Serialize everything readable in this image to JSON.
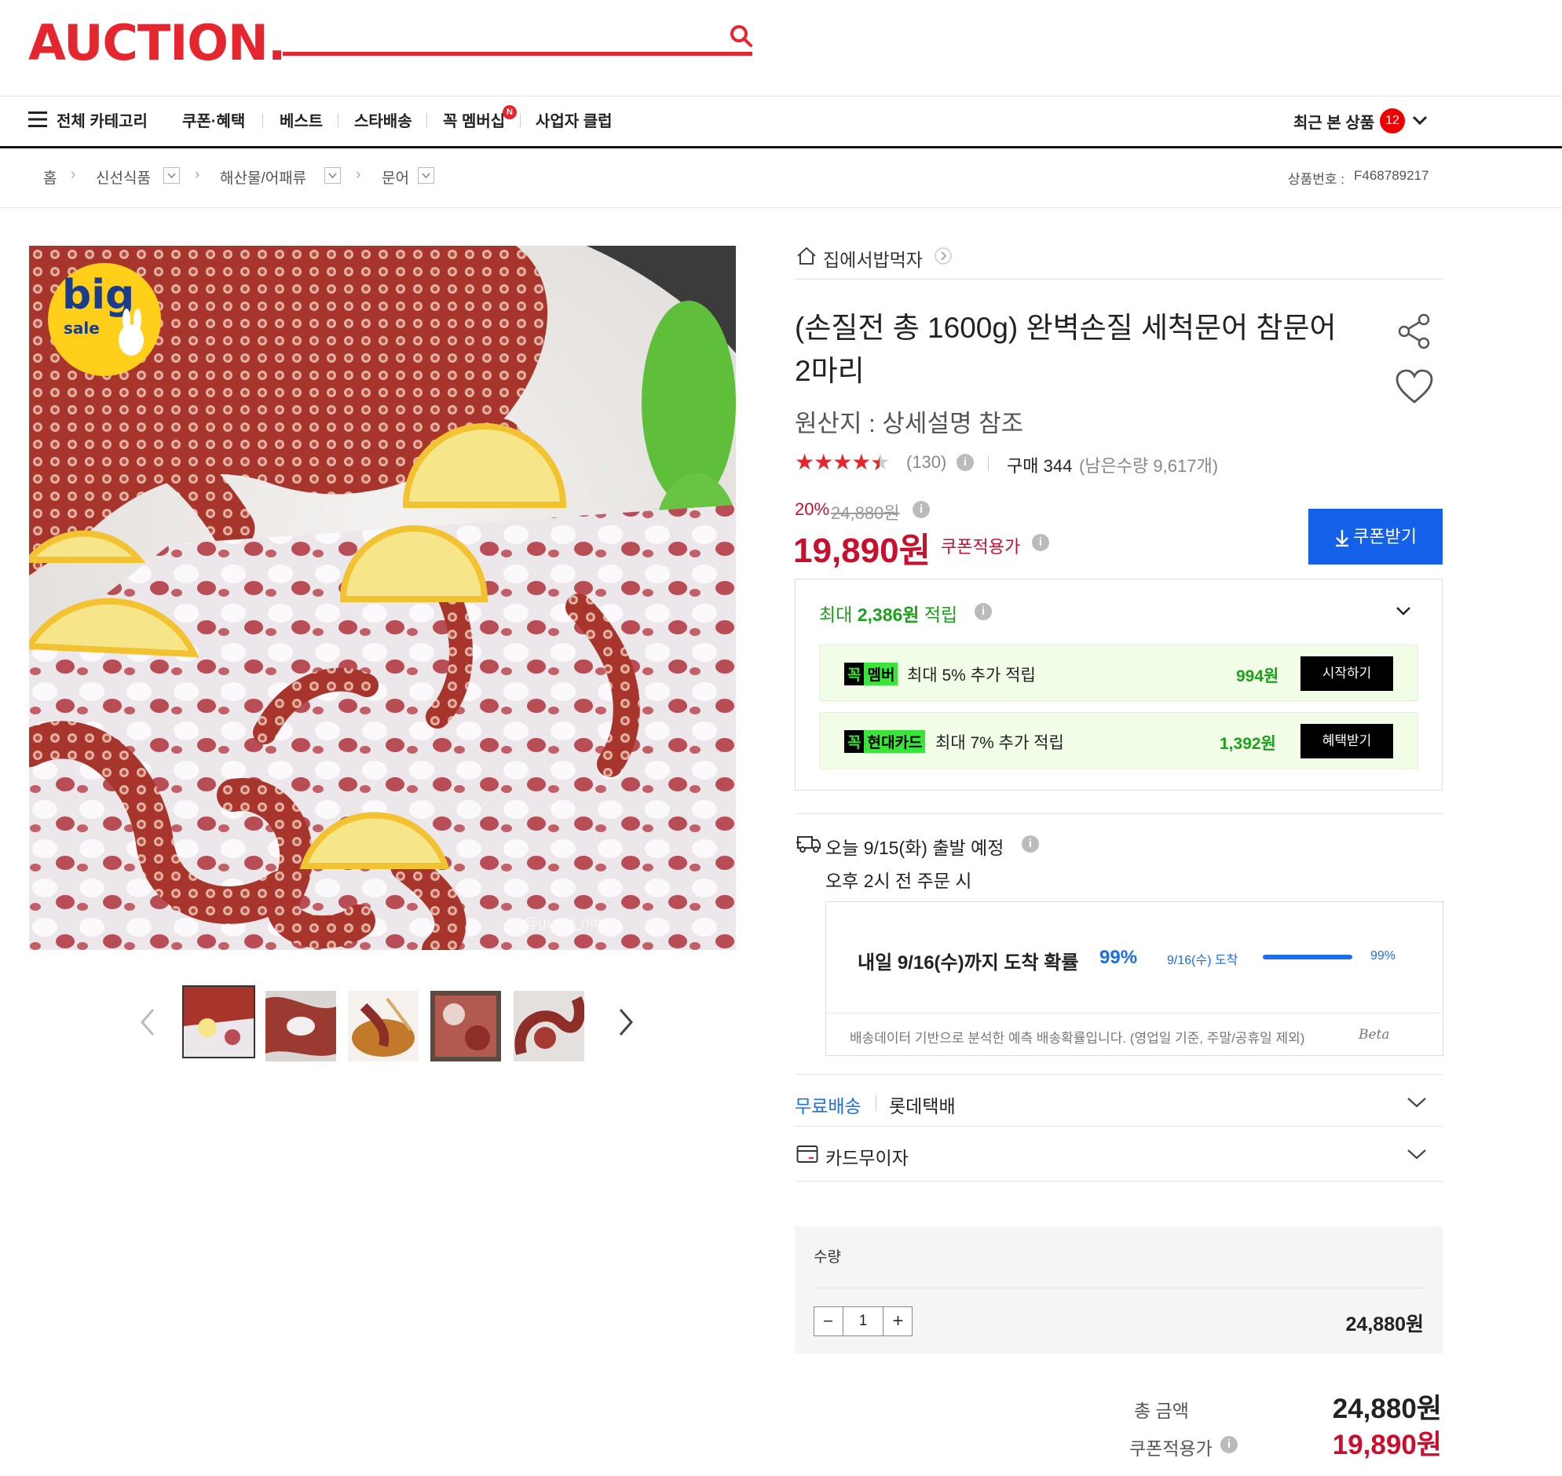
{
  "header": {
    "logo": "AUCTION.",
    "nav": {
      "all_category": "전체 카테고리",
      "items": [
        "쿠폰·혜택",
        "베스트",
        "스타배송",
        "꼭 멤버십",
        "사업자 클럽"
      ],
      "new_badge": "N",
      "recent_label": "최근 본 상품",
      "recent_count": "12"
    }
  },
  "breadcrumb": {
    "home": "홈",
    "levels": [
      "신선식품",
      "해산물/어패류",
      "문어"
    ],
    "product_no_label": "상품번호 :",
    "product_no": "F468789217"
  },
  "product": {
    "badge_big": "big",
    "badge_sale": "sale",
    "watermark": "@gugu_nini",
    "seller": "집에서밥먹자",
    "title": "(손질전 총 1600g) 완벽손질 세척문어 참문어 2마리",
    "origin": "원산지 : 상세설명 참조",
    "rating": 4.5,
    "review_count": "(130)",
    "purchase_label": "구매 344",
    "stock": "(남은수량 9,617개)",
    "discount_rate": "20%",
    "original_price": "24,880원",
    "coupon_price": "19,890원",
    "coupon_price_label": "쿠폰적용가",
    "coupon_button": "쿠폰받기"
  },
  "rewards": {
    "max_label_pre": "최대 ",
    "max_amount": "2,386원",
    "max_label_post": " 적립",
    "rows": [
      {
        "tag1": "꼭",
        "tag2": "멤버",
        "text": "최대 5% 추가 적립",
        "amount": "994원",
        "button": "시작하기"
      },
      {
        "tag1": "꼭",
        "tag2": "현대카드",
        "text": "최대 7% 추가 적립",
        "amount": "1,392원",
        "button": "혜택받기"
      }
    ]
  },
  "delivery": {
    "ship_text": "오늘 9/15(화) 출발 예정",
    "cutoff": "오후 2시 전 주문 시",
    "arrival_text": "내일 9/16(수)까지 도착 확률",
    "arrival_prob": "99%",
    "bar_label": "9/16(수) 도착",
    "bar_pct": "99%",
    "bar_fraction": 0.99,
    "note": "배송데이터 기반으로 분석한 예측 배송확률입니다. (영업일 기준, 주말/공휴일 제외)",
    "beta": "Beta",
    "free_shipping": "무료배송",
    "carrier": "롯데택배",
    "card_installment": "카드무이자"
  },
  "quantity": {
    "label": "수량",
    "value": "1",
    "minus": "−",
    "plus": "+",
    "line_price": "24,880원"
  },
  "totals": {
    "total_label": "총 금액",
    "total": "24,880원",
    "coupon_label": "쿠폰적용가",
    "coupon_total": "19,890원"
  },
  "colors": {
    "brand_red": "#e5262e",
    "price_red": "#c8102e",
    "button_blue": "#1460e8",
    "reward_green": "#1ba11b",
    "tag_green": "#3ae43a",
    "link_blue": "#1a6ee6"
  }
}
